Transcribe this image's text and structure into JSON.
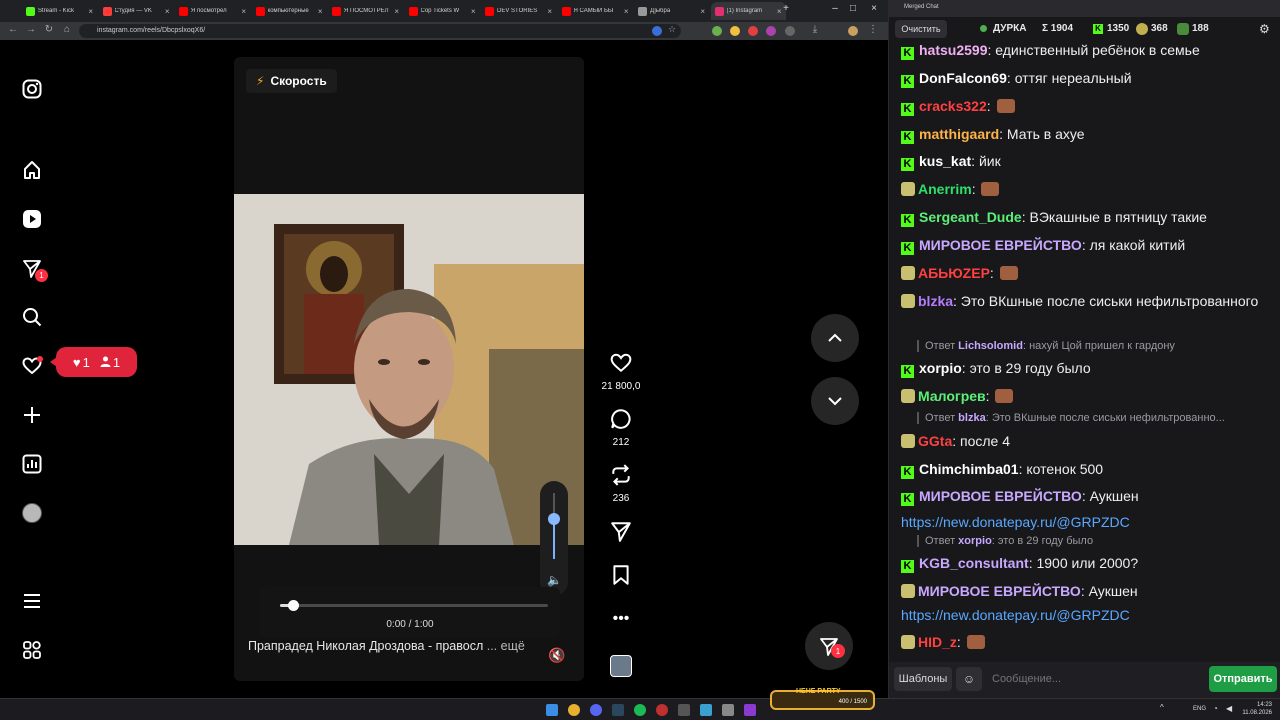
{
  "browser": {
    "tabs": [
      {
        "title": "Stream - Kick",
        "color": "#53fc18"
      },
      {
        "title": "Студия — VK",
        "color": "#ff3b3b"
      },
      {
        "title": "Я посмотрел",
        "color": "#ff0000"
      },
      {
        "title": "компьютерные",
        "color": "#ff0000"
      },
      {
        "title": "Я ПОСМОТРЕЛ",
        "color": "#ff0000"
      },
      {
        "title": "Cop Tickets W",
        "color": "#ff0000"
      },
      {
        "title": "DEV STORIES",
        "color": "#ff0000"
      },
      {
        "title": "Я САМЫЙ БЫ",
        "color": "#ff0000"
      },
      {
        "title": "Д]ыбра",
        "color": "#999999"
      },
      {
        "title": "(1) Instagram",
        "color": "#e1306c"
      }
    ],
    "url": "instagram.com/reels/DbcpslxoqX6/"
  },
  "instagram": {
    "notification": {
      "likes": "1",
      "follows": "1"
    },
    "messages_badge": "1",
    "speed_label": "Скорость",
    "time": "0:00 / 1:00",
    "progress": 0.05,
    "volume_level": 0.6,
    "caption": "Прапрадед Николая Дроздова - правосл",
    "more": "... ещё",
    "likes_count": "21 800,0",
    "comments_count": "212",
    "reposts_count": "236",
    "dm_badge": "1"
  },
  "chat": {
    "window_title": "Merged Chat",
    "clear_label": "Очистить",
    "stats": {
      "streamer": "ДУРКА",
      "sum": "Σ 1904",
      "kick": "1350",
      "other1": "368",
      "other2": "188"
    },
    "messages": [
      {
        "user": "hatsu2599",
        "color": "#f0b0f0",
        "text": "единственный ребёнок в семье",
        "src": "kick"
      },
      {
        "user": "DonFalcon69",
        "color": "#ffffff",
        "text": "оттяг нереальный",
        "src": "kick"
      },
      {
        "user": "cracks322",
        "color": "#ff4040",
        "text": "",
        "src": "kick",
        "emote": true
      },
      {
        "user": "matthigaard",
        "color": "#ffb347",
        "text": "Мать в ахуе",
        "src": "kick"
      },
      {
        "user": "kus_kat",
        "color": "#ffffff",
        "text": "йик",
        "src": "kick"
      },
      {
        "user": "Anerrim",
        "color": "#2ee06a",
        "text": "",
        "src": "twitch",
        "emote": true
      },
      {
        "user": "Sergeant_Dude",
        "color": "#5af078",
        "text": "ВЭкашные в пятницу такие",
        "src": "kick"
      },
      {
        "user": "МИРОВОЕ ЕВРЕЙСТВО",
        "color": "#c8a8ff",
        "text": "ля какой китий",
        "src": "kick"
      },
      {
        "user": "АБЬЮZЕР",
        "color": "#ff4040",
        "text": "",
        "src": "twitch",
        "emote": true
      },
      {
        "user": "blzka",
        "color": "#b67cff",
        "text": "Это ВКшные после сиськи нефильтрованного",
        "src": "twitch"
      },
      {
        "user": "xorpio",
        "color": "#ffffff",
        "text": "это в 29 году было",
        "src": "kick"
      },
      {
        "user": "Малогрев",
        "color": "#5af078",
        "text": "",
        "src": "twitch",
        "emote": true
      },
      {
        "user": "GGta",
        "color": "#ff4040",
        "text": "после 4",
        "src": "twitch"
      },
      {
        "user": "Chimchimba01",
        "color": "#ffffff",
        "text": "котенок 500",
        "src": "kick"
      },
      {
        "user": "МИРОВОЕ ЕВРЕЙСТВО",
        "color": "#c8a8ff",
        "text": "Аукшен",
        "src": "kick"
      },
      {
        "user": "KGB_consultant",
        "color": "#c8a8ff",
        "text": "1900 или 2000?",
        "src": "kick"
      },
      {
        "user": "МИРОВОЕ ЕВРЕЙСТВО",
        "color": "#c8a8ff",
        "text": "Аукшен",
        "src": "twitch"
      },
      {
        "user": "HID_z",
        "color": "#ff4040",
        "text": "",
        "src": "twitch",
        "emote": true
      }
    ],
    "link1": "https://new.donatepay.ru/@GRPZDC",
    "link2": "https://new.donatepay.ru/@GRPZDC",
    "replies": [
      {
        "prefix": "Ответ",
        "user": "Lichsolomid",
        "text": "нахуй Цой пришел к гардону"
      },
      {
        "prefix": "Ответ",
        "user": "blzka",
        "text": "Это ВКшные после сиськи нефильтрованно..."
      },
      {
        "prefix": "Ответ",
        "user": "xorpio",
        "text": "это в 29 году было"
      }
    ],
    "templates_label": "Шаблоны",
    "input_placeholder": "Сообщение...",
    "send_label": "Отправить"
  },
  "taskbar": {
    "hype_label": "HEHE PARTY",
    "hype_value": "400 / 1500",
    "lang": "ENG",
    "time": "14:23",
    "date": "11.08.2026"
  }
}
